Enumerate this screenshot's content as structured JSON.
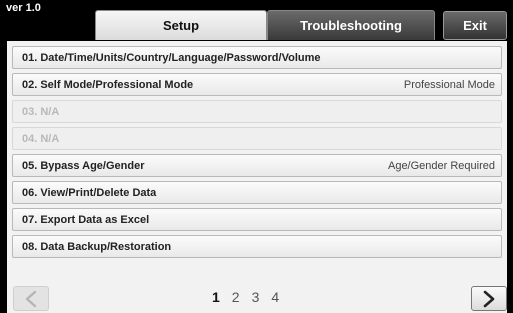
{
  "header": {
    "version": "ver 1.0",
    "tabs": [
      {
        "label": "Setup",
        "active": true
      },
      {
        "label": "Troubleshooting",
        "active": false
      }
    ],
    "exit_label": "Exit"
  },
  "menu": {
    "items": [
      {
        "label": "01. Date/Time/Units/Country/Language/Password/Volume",
        "value": "",
        "enabled": true
      },
      {
        "label": "02. Self Mode/Professional Mode",
        "value": "Professional Mode",
        "enabled": true
      },
      {
        "label": "03. N/A",
        "value": "",
        "enabled": false
      },
      {
        "label": "04. N/A",
        "value": "",
        "enabled": false
      },
      {
        "label": "05. Bypass Age/Gender",
        "value": "Age/Gender Required",
        "enabled": true
      },
      {
        "label": "06. View/Print/Delete Data",
        "value": "",
        "enabled": true
      },
      {
        "label": "07. Export Data as Excel",
        "value": "",
        "enabled": true
      },
      {
        "label": "08. Data Backup/Restoration",
        "value": "",
        "enabled": true
      }
    ]
  },
  "pagination": {
    "pages": [
      "1",
      "2",
      "3",
      "4"
    ],
    "current": 1,
    "prev_icon": "chevron-left-icon",
    "next_icon": "chevron-right-icon"
  },
  "colors": {
    "background": "#000000",
    "panel": "#f2f2f2",
    "disabled_text": "#b8b8b8"
  }
}
